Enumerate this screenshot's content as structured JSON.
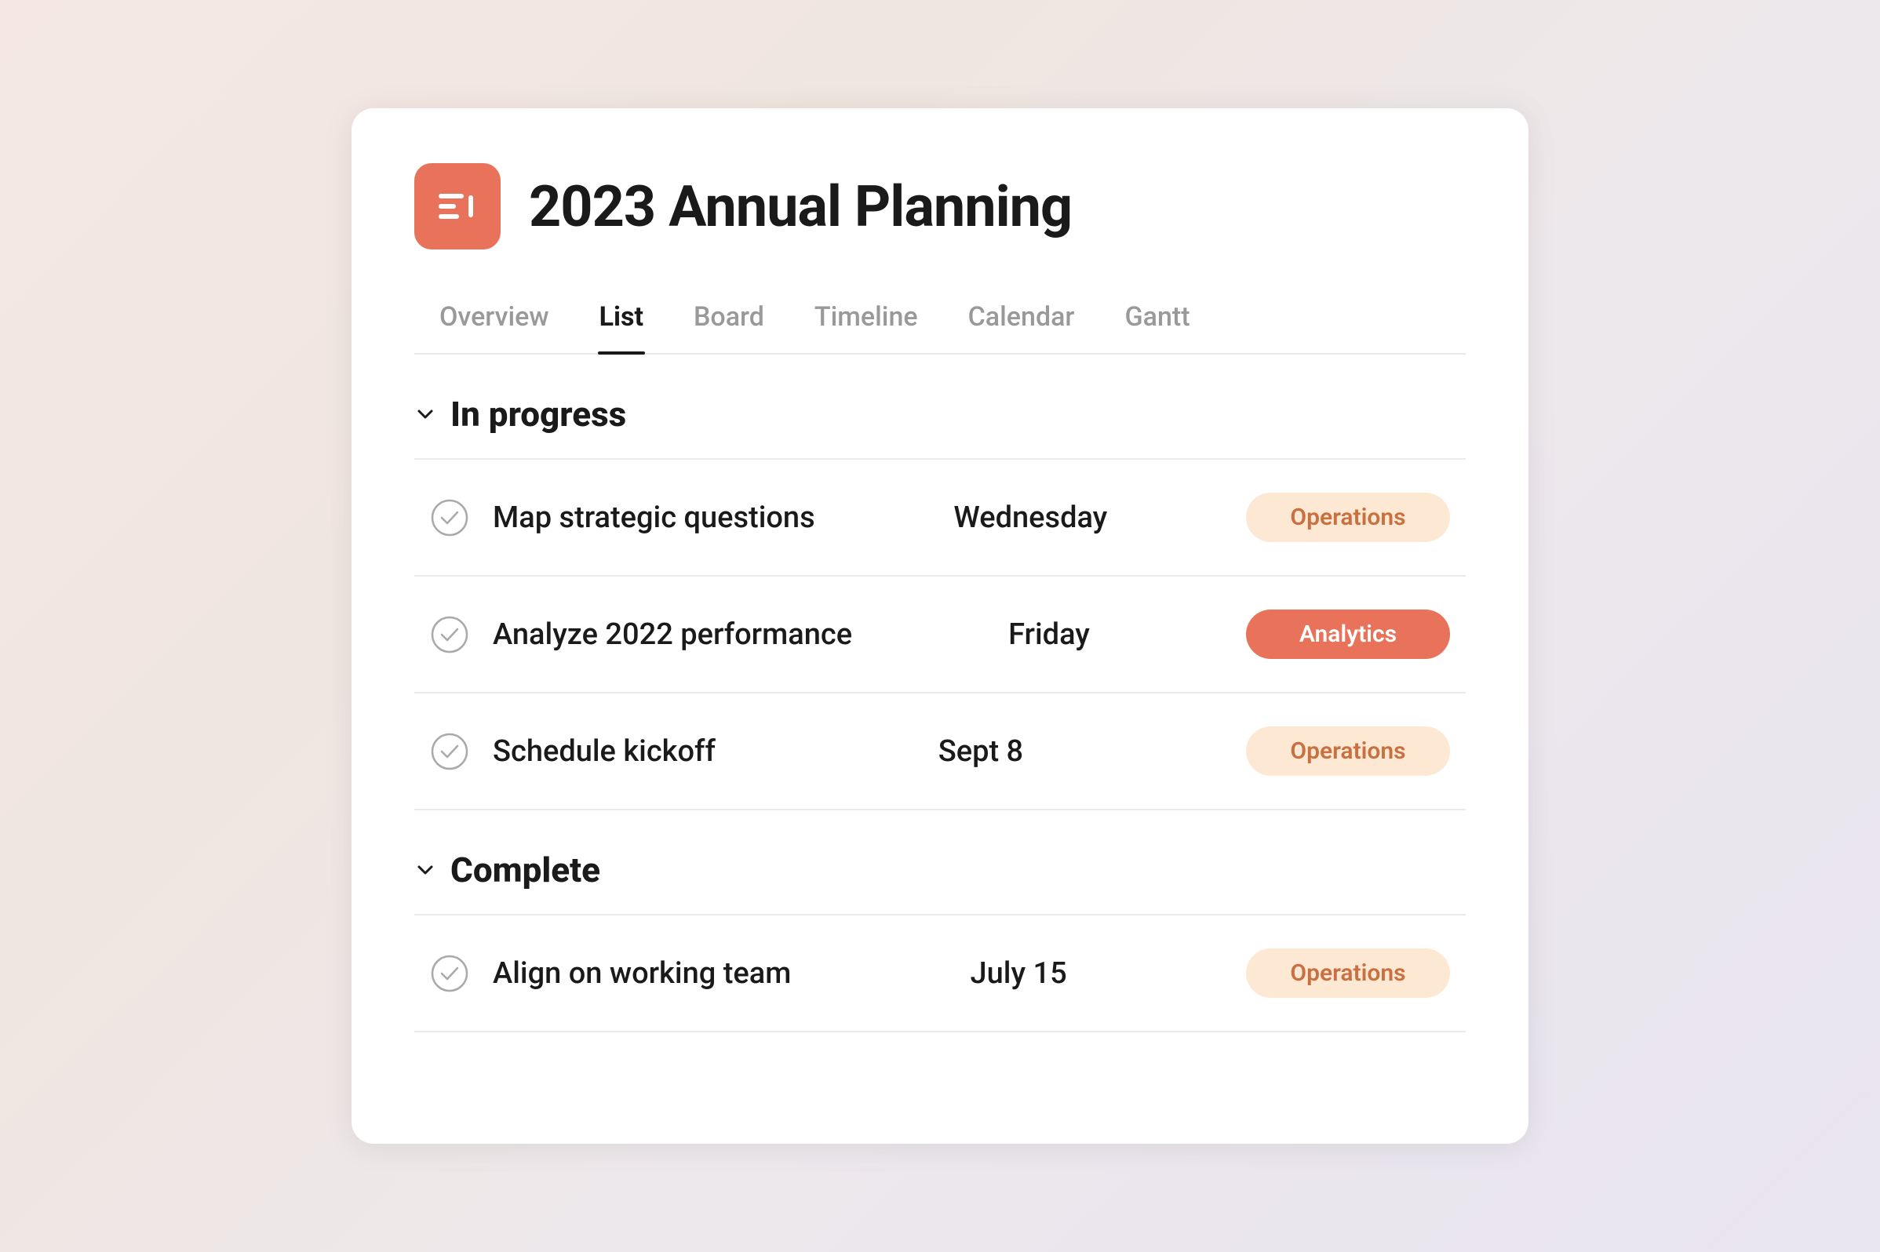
{
  "header": {
    "project_title": "2023 Annual Planning",
    "icon_alt": "project-icon"
  },
  "tabs": [
    {
      "label": "Overview",
      "active": false
    },
    {
      "label": "List",
      "active": true
    },
    {
      "label": "Board",
      "active": false
    },
    {
      "label": "Timeline",
      "active": false
    },
    {
      "label": "Calendar",
      "active": false
    },
    {
      "label": "Gantt",
      "active": false
    }
  ],
  "sections": [
    {
      "title": "In progress",
      "tasks": [
        {
          "name": "Map strategic questions",
          "date": "Wednesday",
          "tag": "Operations",
          "tag_type": "operations"
        },
        {
          "name": "Analyze 2022 performance",
          "date": "Friday",
          "tag": "Analytics",
          "tag_type": "analytics"
        },
        {
          "name": "Schedule kickoff",
          "date": "Sept 8",
          "tag": "Operations",
          "tag_type": "operations"
        }
      ]
    },
    {
      "title": "Complete",
      "tasks": [
        {
          "name": "Align on working team",
          "date": "July 15",
          "tag": "Operations",
          "tag_type": "operations"
        }
      ]
    }
  ]
}
